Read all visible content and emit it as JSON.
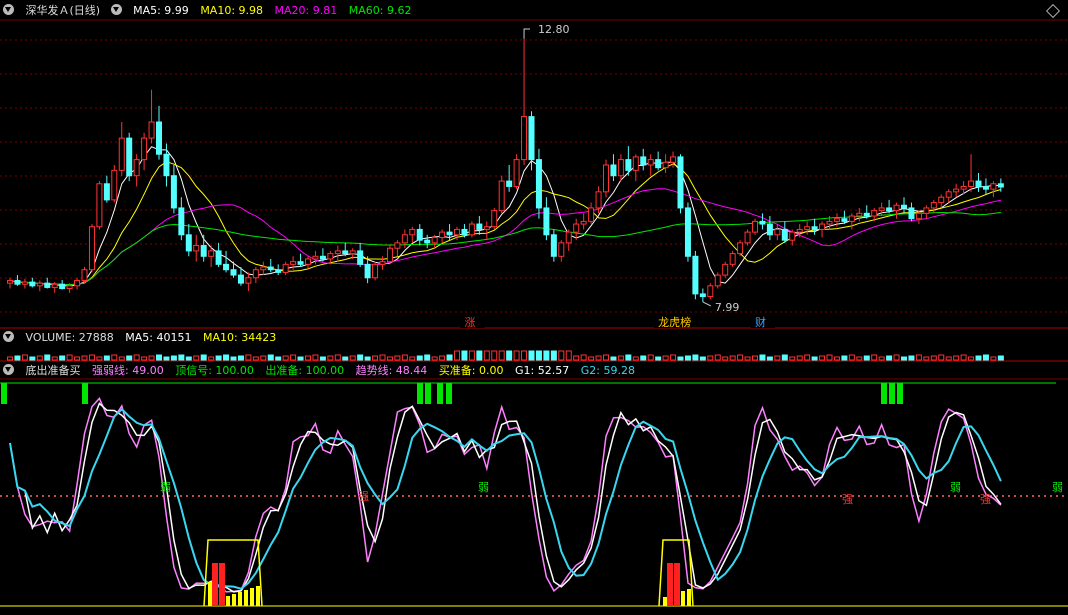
{
  "header_main": {
    "title": "深华发Ａ(日线)",
    "ma5": "MA5: 9.99",
    "ma10": "MA10: 9.98",
    "ma20": "MA20: 9.81",
    "ma60": "MA60: 9.62"
  },
  "header_volume": {
    "title": "VOLUME: 27888",
    "ma5": "MA5: 40151",
    "ma10": "MA10: 34423"
  },
  "header_indicator": {
    "title": "底出准备买",
    "strong_weak": "强弱线: 49.00",
    "top_signal": "顶信号: 100.00",
    "out_ready": "出准备: 100.00",
    "trend": "趋势线: 48.44",
    "buy_ready": "买准备: 0.00",
    "g1": "G1: 52.57",
    "g2": "G2: 59.28"
  },
  "colors": {
    "up": "#ff3232",
    "down": "#54ffff",
    "ma5": "#ffffff",
    "ma10": "#ffff00",
    "ma20": "#ff00ff",
    "ma60": "#00e600",
    "g1": "#ffffff",
    "g2": "#39d7ef",
    "strong_weak": "#ff80ff",
    "grid": "#7a0000"
  },
  "chart_data": {
    "type": "candlestick",
    "ylim": [
      7.7,
      12.95
    ],
    "candles": [
      [
        8.2,
        8.3,
        8.1,
        8.25
      ],
      [
        8.25,
        8.35,
        8.15,
        8.18
      ],
      [
        8.18,
        8.28,
        8.1,
        8.22
      ],
      [
        8.22,
        8.3,
        8.12,
        8.15
      ],
      [
        8.15,
        8.25,
        8.05,
        8.2
      ],
      [
        8.2,
        8.3,
        8.1,
        8.12
      ],
      [
        8.12,
        8.22,
        8.02,
        8.18
      ],
      [
        8.18,
        8.26,
        8.08,
        8.1
      ],
      [
        8.1,
        8.2,
        8.02,
        8.15
      ],
      [
        8.15,
        8.3,
        8.08,
        8.25
      ],
      [
        8.25,
        8.5,
        8.2,
        8.45
      ],
      [
        8.45,
        9.3,
        8.4,
        9.25
      ],
      [
        9.25,
        10.1,
        9.2,
        10.05
      ],
      [
        10.05,
        10.2,
        9.7,
        9.75
      ],
      [
        9.75,
        10.4,
        9.7,
        10.3
      ],
      [
        10.3,
        11.2,
        10.2,
        10.9
      ],
      [
        10.9,
        11.0,
        10.1,
        10.2
      ],
      [
        10.2,
        10.6,
        10.0,
        10.5
      ],
      [
        10.5,
        11.0,
        10.3,
        10.9
      ],
      [
        10.9,
        11.8,
        10.8,
        11.2
      ],
      [
        11.2,
        11.5,
        10.5,
        10.6
      ],
      [
        10.6,
        10.8,
        10.0,
        10.2
      ],
      [
        10.2,
        10.4,
        9.5,
        9.6
      ],
      [
        9.6,
        9.8,
        9.0,
        9.1
      ],
      [
        9.1,
        9.3,
        8.7,
        8.8
      ],
      [
        8.8,
        9.1,
        8.6,
        8.9
      ],
      [
        8.9,
        9.1,
        8.6,
        8.7
      ],
      [
        8.7,
        8.9,
        8.5,
        8.8
      ],
      [
        8.8,
        8.95,
        8.5,
        8.55
      ],
      [
        8.55,
        8.8,
        8.4,
        8.45
      ],
      [
        8.45,
        8.6,
        8.3,
        8.35
      ],
      [
        8.35,
        8.5,
        8.15,
        8.2
      ],
      [
        8.2,
        8.4,
        8.05,
        8.3
      ],
      [
        8.3,
        8.5,
        8.2,
        8.45
      ],
      [
        8.45,
        8.6,
        8.35,
        8.5
      ],
      [
        8.5,
        8.65,
        8.4,
        8.45
      ],
      [
        8.45,
        8.55,
        8.35,
        8.4
      ],
      [
        8.4,
        8.6,
        8.35,
        8.55
      ],
      [
        8.55,
        8.7,
        8.45,
        8.6
      ],
      [
        8.6,
        8.75,
        8.5,
        8.55
      ],
      [
        8.55,
        8.7,
        8.45,
        8.65
      ],
      [
        8.65,
        8.8,
        8.55,
        8.7
      ],
      [
        8.7,
        8.85,
        8.6,
        8.65
      ],
      [
        8.65,
        8.8,
        8.55,
        8.75
      ],
      [
        8.75,
        8.9,
        8.6,
        8.8
      ],
      [
        8.8,
        8.95,
        8.7,
        8.75
      ],
      [
        8.75,
        8.85,
        8.65,
        8.8
      ],
      [
        8.8,
        8.95,
        8.5,
        8.55
      ],
      [
        8.55,
        8.7,
        8.2,
        8.3
      ],
      [
        8.3,
        8.6,
        8.25,
        8.55
      ],
      [
        8.55,
        8.7,
        8.45,
        8.6
      ],
      [
        8.6,
        8.9,
        8.55,
        8.85
      ],
      [
        8.85,
        9.0,
        8.7,
        8.95
      ],
      [
        8.95,
        9.2,
        8.85,
        9.1
      ],
      [
        9.1,
        9.25,
        8.95,
        9.2
      ],
      [
        9.2,
        9.3,
        8.9,
        9.0
      ],
      [
        9.0,
        9.1,
        8.85,
        8.95
      ],
      [
        8.95,
        9.1,
        8.85,
        9.05
      ],
      [
        9.05,
        9.2,
        8.95,
        9.15
      ],
      [
        9.15,
        9.3,
        9.0,
        9.1
      ],
      [
        9.1,
        9.25,
        9.0,
        9.2
      ],
      [
        9.2,
        9.3,
        9.05,
        9.1
      ],
      [
        9.1,
        9.35,
        9.05,
        9.3
      ],
      [
        9.3,
        9.45,
        9.1,
        9.2
      ],
      [
        9.2,
        9.35,
        9.0,
        9.25
      ],
      [
        9.25,
        9.6,
        9.2,
        9.55
      ],
      [
        9.55,
        10.2,
        9.5,
        10.1
      ],
      [
        10.1,
        10.4,
        9.9,
        10.0
      ],
      [
        10.0,
        10.6,
        9.95,
        10.5
      ],
      [
        10.5,
        12.75,
        10.4,
        11.3
      ],
      [
        11.3,
        11.4,
        10.3,
        10.5
      ],
      [
        10.5,
        10.7,
        9.4,
        9.6
      ],
      [
        9.6,
        9.8,
        9.0,
        9.1
      ],
      [
        9.1,
        9.2,
        8.6,
        8.7
      ],
      [
        8.7,
        9.0,
        8.6,
        8.95
      ],
      [
        8.95,
        9.2,
        8.8,
        9.15
      ],
      [
        9.15,
        9.4,
        9.0,
        9.3
      ],
      [
        9.3,
        9.5,
        9.2,
        9.35
      ],
      [
        9.35,
        9.7,
        9.3,
        9.6
      ],
      [
        9.6,
        10.0,
        9.5,
        9.9
      ],
      [
        9.9,
        10.5,
        9.8,
        10.4
      ],
      [
        10.4,
        10.6,
        10.1,
        10.2
      ],
      [
        10.2,
        10.6,
        10.1,
        10.5
      ],
      [
        10.5,
        10.75,
        10.2,
        10.3
      ],
      [
        10.3,
        10.6,
        10.1,
        10.55
      ],
      [
        10.55,
        10.7,
        10.3,
        10.4
      ],
      [
        10.4,
        10.6,
        10.2,
        10.5
      ],
      [
        10.5,
        10.65,
        10.3,
        10.35
      ],
      [
        10.35,
        10.6,
        10.25,
        10.45
      ],
      [
        10.45,
        10.65,
        10.35,
        10.55
      ],
      [
        10.55,
        10.6,
        9.5,
        9.6
      ],
      [
        9.6,
        9.7,
        8.6,
        8.7
      ],
      [
        8.7,
        8.8,
        7.9,
        8.0
      ],
      [
        8.0,
        8.1,
        7.85,
        7.95
      ],
      [
        7.95,
        8.2,
        7.9,
        8.15
      ],
      [
        8.15,
        8.4,
        8.1,
        8.35
      ],
      [
        8.35,
        8.6,
        8.3,
        8.55
      ],
      [
        8.55,
        8.8,
        8.5,
        8.75
      ],
      [
        8.75,
        9.0,
        8.7,
        8.95
      ],
      [
        8.95,
        9.2,
        8.9,
        9.15
      ],
      [
        9.15,
        9.4,
        9.1,
        9.35
      ],
      [
        9.35,
        9.5,
        9.2,
        9.3
      ],
      [
        9.3,
        9.45,
        9.0,
        9.1
      ],
      [
        9.1,
        9.3,
        9.0,
        9.2
      ],
      [
        9.2,
        9.35,
        8.95,
        9.0
      ],
      [
        9.0,
        9.2,
        8.9,
        9.15
      ],
      [
        9.15,
        9.3,
        9.05,
        9.2
      ],
      [
        9.2,
        9.35,
        9.1,
        9.25
      ],
      [
        9.25,
        9.4,
        9.1,
        9.2
      ],
      [
        9.2,
        9.35,
        9.05,
        9.3
      ],
      [
        9.3,
        9.45,
        9.2,
        9.35
      ],
      [
        9.35,
        9.5,
        9.25,
        9.4
      ],
      [
        9.4,
        9.55,
        9.3,
        9.35
      ],
      [
        9.35,
        9.5,
        9.2,
        9.45
      ],
      [
        9.45,
        9.6,
        9.35,
        9.5
      ],
      [
        9.5,
        9.65,
        9.4,
        9.45
      ],
      [
        9.45,
        9.6,
        9.35,
        9.55
      ],
      [
        9.55,
        9.7,
        9.45,
        9.6
      ],
      [
        9.6,
        9.75,
        9.5,
        9.55
      ],
      [
        9.55,
        9.7,
        9.4,
        9.65
      ],
      [
        9.65,
        9.8,
        9.5,
        9.6
      ],
      [
        9.6,
        9.7,
        9.35,
        9.4
      ],
      [
        9.4,
        9.55,
        9.3,
        9.5
      ],
      [
        9.5,
        9.65,
        9.4,
        9.6
      ],
      [
        9.6,
        9.75,
        9.5,
        9.7
      ],
      [
        9.7,
        9.85,
        9.6,
        9.8
      ],
      [
        9.8,
        9.95,
        9.7,
        9.9
      ],
      [
        9.9,
        10.05,
        9.8,
        9.95
      ],
      [
        9.95,
        10.1,
        9.85,
        10.0
      ],
      [
        10.0,
        10.6,
        9.9,
        10.1
      ],
      [
        10.1,
        10.25,
        9.9,
        10.0
      ],
      [
        10.0,
        10.15,
        9.85,
        9.95
      ],
      [
        9.95,
        10.1,
        9.8,
        10.05
      ],
      [
        10.05,
        10.15,
        9.9,
        9.99
      ]
    ],
    "price_labels": {
      "high": "12.80",
      "low": "7.99"
    },
    "event_tags": [
      "涨",
      "龙虎榜",
      "财"
    ],
    "indicator_signals": {
      "weak": "弱",
      "strong": "强"
    }
  }
}
